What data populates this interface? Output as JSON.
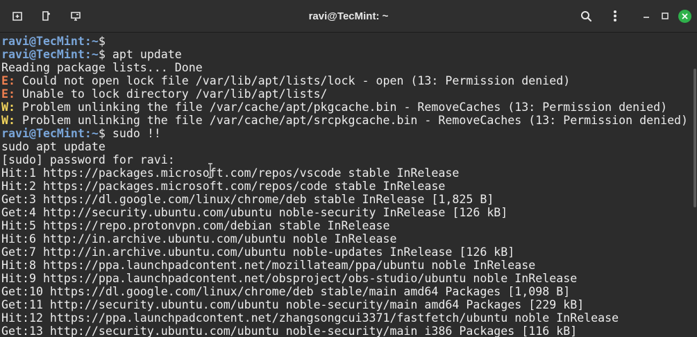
{
  "window": {
    "title": "ravi@TecMint: ~"
  },
  "titlebar_icons": {
    "new_tab": "new-tab-icon",
    "split": "split-view-icon",
    "sessions": "sessions-icon",
    "search": "search-icon",
    "menu": "kebab-menu-icon",
    "minimize": "minimize-icon",
    "maximize": "maximize-icon",
    "close": "close-icon"
  },
  "colors": {
    "background": "#2c2c2c",
    "prompt": "#7aa6da",
    "error_tag": "#f08050",
    "warning_tag": "#f2d45c",
    "close_button": "#2fb14b"
  },
  "prompt": {
    "user_host": "ravi@TecMint",
    "path": ":~",
    "symbol": "$"
  },
  "lines": [
    {
      "type": "prompt",
      "cmd": ""
    },
    {
      "type": "prompt",
      "cmd": " apt update"
    },
    {
      "type": "out",
      "text": "Reading package lists... Done"
    },
    {
      "type": "tagged",
      "tag": "E:",
      "level": "error",
      "text": " Could not open lock file /var/lib/apt/lists/lock - open (13: Permission denied)"
    },
    {
      "type": "tagged",
      "tag": "E:",
      "level": "error",
      "text": " Unable to lock directory /var/lib/apt/lists/"
    },
    {
      "type": "tagged",
      "tag": "W:",
      "level": "warning",
      "text": " Problem unlinking the file /var/cache/apt/pkgcache.bin - RemoveCaches (13: Permission denied)"
    },
    {
      "type": "tagged",
      "tag": "W:",
      "level": "warning",
      "text": " Problem unlinking the file /var/cache/apt/srcpkgcache.bin - RemoveCaches (13: Permission denied)"
    },
    {
      "type": "prompt",
      "cmd": " sudo !!"
    },
    {
      "type": "out",
      "text": "sudo apt update"
    },
    {
      "type": "out",
      "text": "[sudo] password for ravi:"
    },
    {
      "type": "out",
      "text": "Hit:1 https://packages.microsoft.com/repos/vscode stable InRelease"
    },
    {
      "type": "out",
      "text": "Hit:2 https://packages.microsoft.com/repos/code stable InRelease"
    },
    {
      "type": "out",
      "text": "Get:3 https://dl.google.com/linux/chrome/deb stable InRelease [1,825 B]"
    },
    {
      "type": "out",
      "text": "Get:4 http://security.ubuntu.com/ubuntu noble-security InRelease [126 kB]"
    },
    {
      "type": "out",
      "text": "Hit:5 https://repo.protonvpn.com/debian stable InRelease"
    },
    {
      "type": "out",
      "text": "Hit:6 http://in.archive.ubuntu.com/ubuntu noble InRelease"
    },
    {
      "type": "out",
      "text": "Get:7 http://in.archive.ubuntu.com/ubuntu noble-updates InRelease [126 kB]"
    },
    {
      "type": "out",
      "text": "Hit:8 https://ppa.launchpadcontent.net/mozillateam/ppa/ubuntu noble InRelease"
    },
    {
      "type": "out",
      "text": "Hit:9 https://ppa.launchpadcontent.net/obsproject/obs-studio/ubuntu noble InRelease"
    },
    {
      "type": "out",
      "text": "Get:10 https://dl.google.com/linux/chrome/deb stable/main amd64 Packages [1,098 B]"
    },
    {
      "type": "out",
      "text": "Get:11 http://security.ubuntu.com/ubuntu noble-security/main amd64 Packages [229 kB]"
    },
    {
      "type": "out",
      "text": "Hit:12 https://ppa.launchpadcontent.net/zhangsongcui3371/fastfetch/ubuntu noble InRelease"
    },
    {
      "type": "out",
      "text": "Get:13 http://security.ubuntu.com/ubuntu noble-security/main i386 Packages [116 kB]"
    }
  ]
}
